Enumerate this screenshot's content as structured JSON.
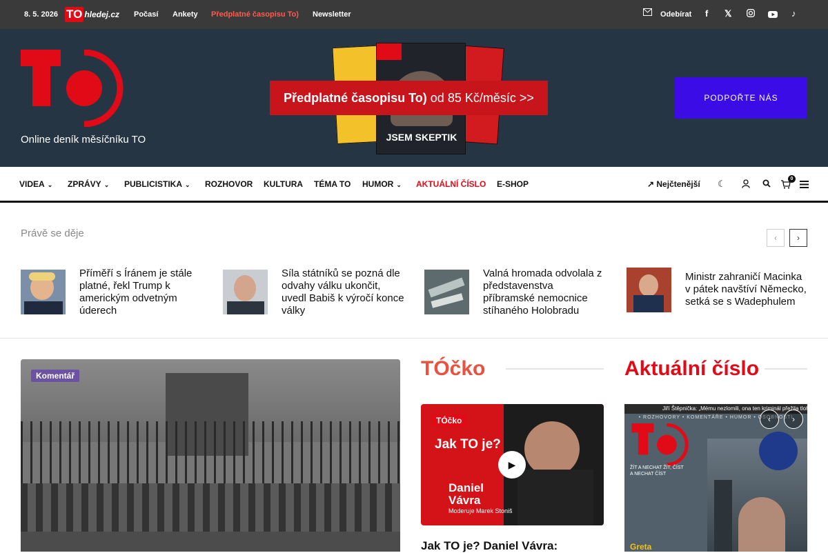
{
  "topbar": {
    "date": "8. 5. 2026",
    "logo_t": "TO",
    "logo_rest": "hledej.cz",
    "links": [
      "Počasí",
      "Ankety",
      "Předplatné časopisu To)",
      "Newsletter"
    ],
    "subscribe": "Odebírat",
    "social": [
      "facebook-icon",
      "x-icon",
      "instagram-icon",
      "youtube-icon",
      "tiktok-icon"
    ]
  },
  "masthead": {
    "tagline": "Online deník měsíčníku TO",
    "promo_bold": "Předplatné časopisu To)",
    "promo_rest": " od 85 Kč/měsíc >>",
    "support": "PODPOŘTE NÁS",
    "magazine_text": "JSEM SKEPTIK"
  },
  "nav": {
    "items": [
      "VIDEA",
      "ZPRÁVY",
      "PUBLICISTIKA",
      "ROZHOVOR",
      "KULTURA",
      "TÉMA TO",
      "HUMOR",
      "AKTUÁLNÍ ČÍSLO",
      "E-SHOP"
    ],
    "trending": "Nejčtenější",
    "cart_count": "0"
  },
  "happening": {
    "label": "Právě se děje",
    "items": [
      {
        "title": "Příměří s Íránem je stále platné, řekl Trump k americkým odvetným úderech"
      },
      {
        "title": "Síla státníků se pozná dle odvahy válku ukončit, uvedl Babiš k výročí konce války"
      },
      {
        "title": "Valná hromada odvolala z představenstva příbramské nemocnice stíhaného Holobradu"
      },
      {
        "title": "Ministr zahraničí Macinka v pátek navštíví Německo, setká se s Wadephulem"
      }
    ]
  },
  "main": {
    "hero_badge": "Komentář",
    "tocko_heading": "TÓčko",
    "tocko_badge": "TÓčko",
    "video_title_line": "Jak TO je? Daniel Vávra:",
    "video_overlay_1": "Jak TO je?",
    "video_overlay_2": "Daniel",
    "video_overlay_3": "Vávra",
    "video_overlay_4": "Moderuje Marek Stoniš",
    "issue_heading": "Aktuální číslo",
    "cover_headline": "Jiří Štěpnička: „Mému nezlomili, ona ten kriminál přežila tloha",
    "cover_sub": "ŽÍT A NECHAT ŽÍT, ČÍST A NECHAT ČÍST",
    "cover_strip": "• ROZHOVORY • KOMENTÁŘE • HUMOR • OSOBNOSTI",
    "cover_name": "Greta"
  },
  "colors": {
    "brand_red": "#e10b17",
    "support_blue": "#3b0ce6",
    "masthead": "#263544"
  }
}
